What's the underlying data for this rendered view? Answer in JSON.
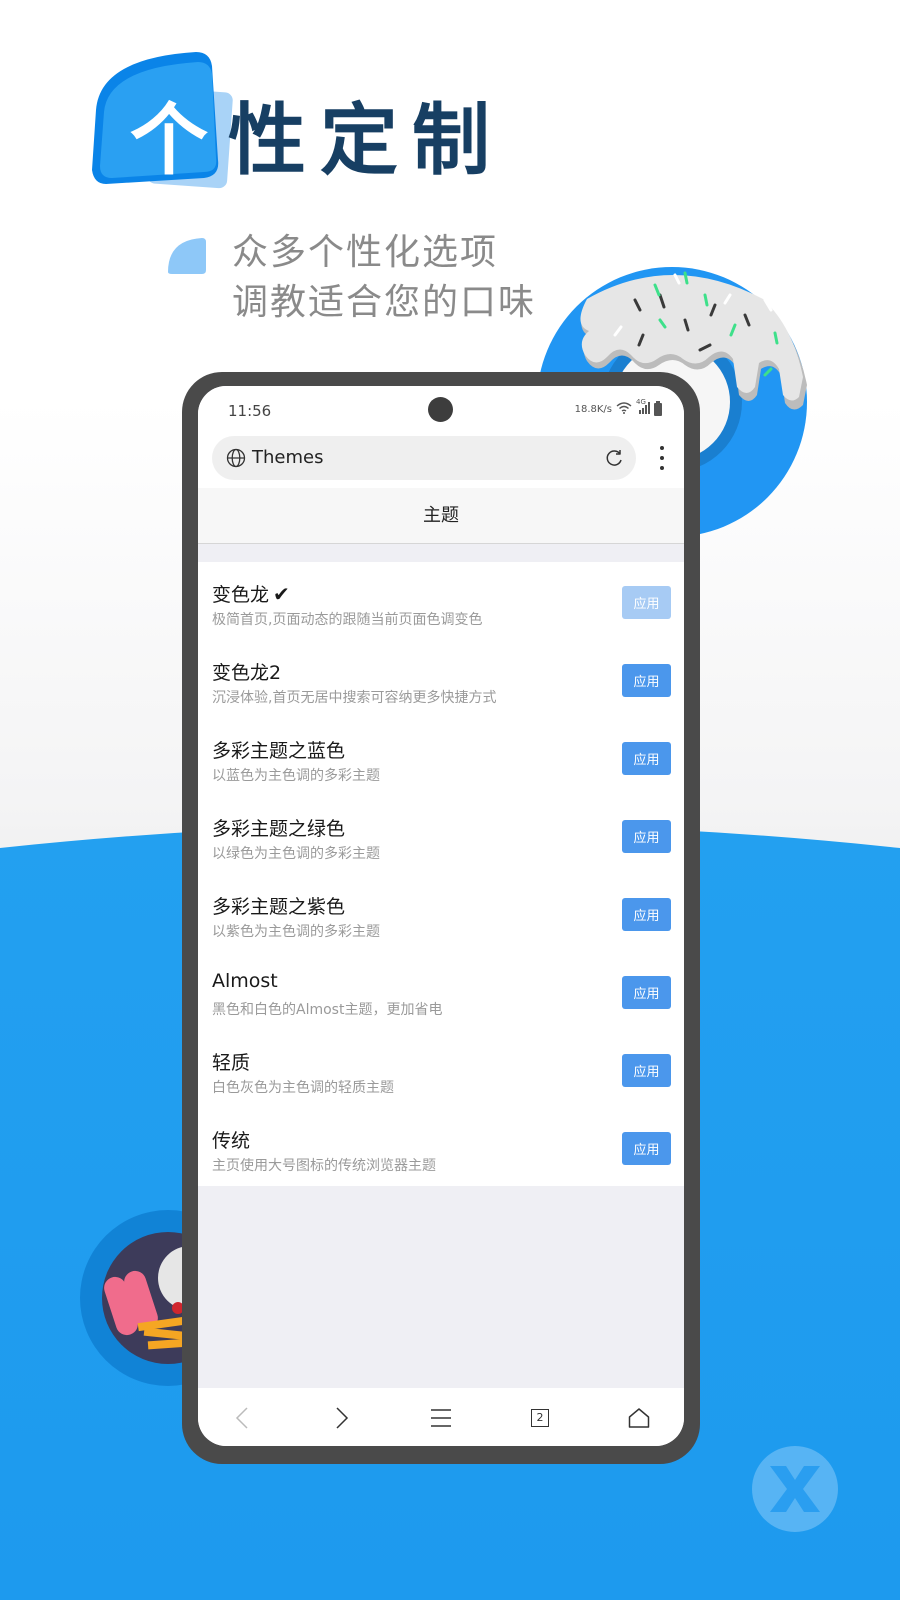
{
  "hero": {
    "title_first_char": "个",
    "title_rest": "性定制",
    "subtitle_line1": "众多个性化选项",
    "subtitle_line2": "调教适合您的口味"
  },
  "colors": {
    "brand_blue": "#2196f3",
    "title_navy": "#173f63",
    "apply_button": "#4b97ec",
    "apply_button_disabled": "#a7cbf4"
  },
  "status_bar": {
    "time": "11:56",
    "network_speed": "18.8K/s",
    "network_type": "4G",
    "icons": [
      "wifi-icon",
      "signal-icon",
      "battery-icon"
    ]
  },
  "browser": {
    "url_text": "Themes",
    "tab_count": "2"
  },
  "page": {
    "title": "主题",
    "themes": [
      {
        "name": "变色龙",
        "description": "极简首页,页面动态的跟随当前页面色调变色",
        "selected": true,
        "button": "应用"
      },
      {
        "name": "变色龙2",
        "description": "沉浸体验,首页无居中搜索可容纳更多快捷方式",
        "selected": false,
        "button": "应用"
      },
      {
        "name": "多彩主题之蓝色",
        "description": "以蓝色为主色调的多彩主题",
        "selected": false,
        "button": "应用"
      },
      {
        "name": "多彩主题之绿色",
        "description": "以绿色为主色调的多彩主题",
        "selected": false,
        "button": "应用"
      },
      {
        "name": "多彩主题之紫色",
        "description": "以紫色为主色调的多彩主题",
        "selected": false,
        "button": "应用"
      },
      {
        "name": "Almost",
        "description": "黑色和白色的Almost主题，更加省电",
        "selected": false,
        "button": "应用"
      },
      {
        "name": "轻质",
        "description": "白色灰色为主色调的轻质主题",
        "selected": false,
        "button": "应用"
      },
      {
        "name": "传统",
        "description": "主页使用大号图标的传统浏览器主题",
        "selected": false,
        "button": "应用"
      }
    ],
    "selected_mark": "✔"
  },
  "bottom_nav": [
    "back-icon",
    "forward-icon",
    "menu-icon",
    "tabs-icon",
    "home-icon"
  ]
}
